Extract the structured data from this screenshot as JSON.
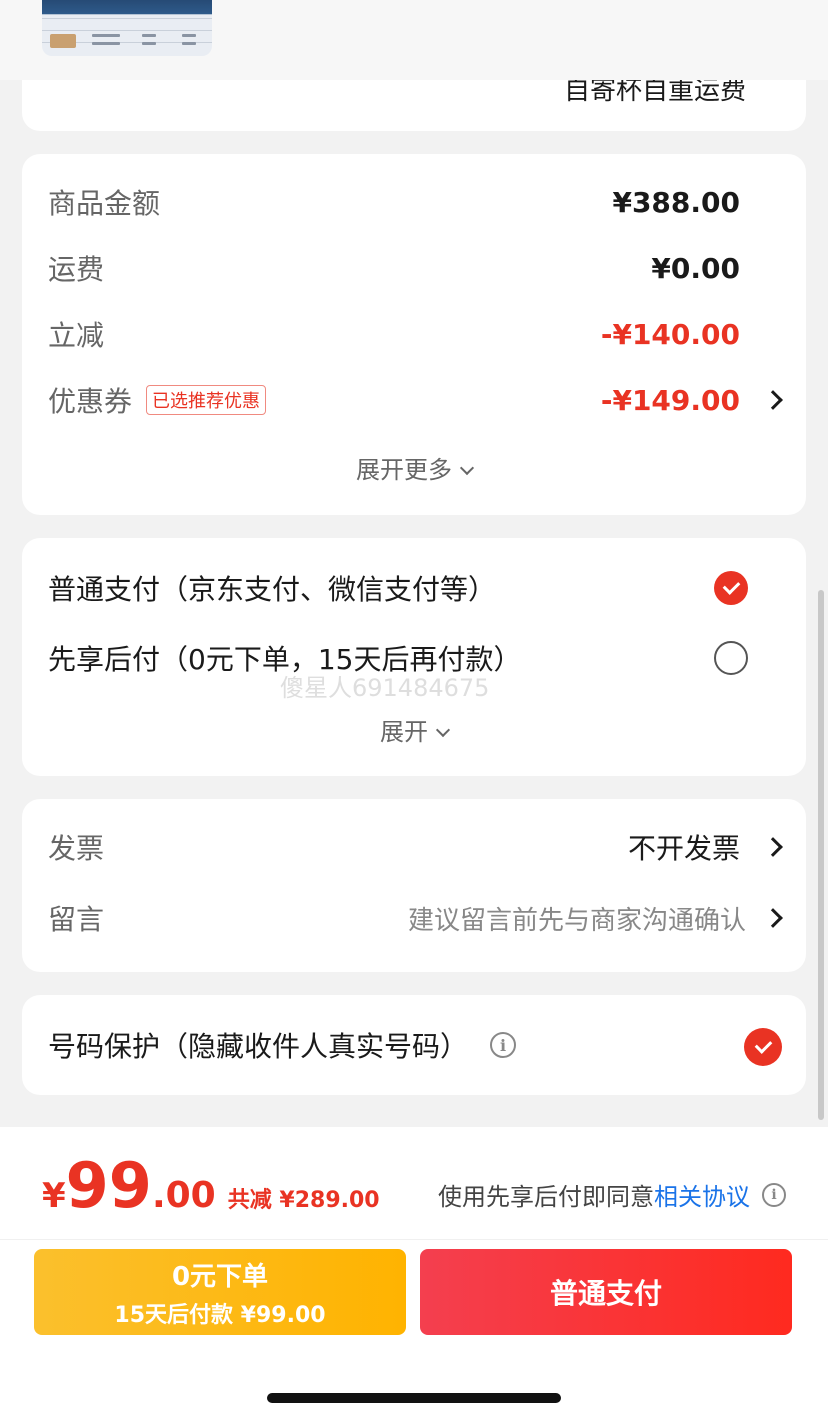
{
  "header": {
    "shipping_text": "自寄杯自重运费"
  },
  "price_summary": {
    "rows": [
      {
        "label": "商品金额",
        "value": "¥388.00"
      },
      {
        "label": "运费",
        "value": "¥0.00"
      },
      {
        "label": "立减",
        "value": "-¥140.00"
      },
      {
        "label": "优惠券",
        "tag": "已选推荐优惠",
        "value": "-¥149.00"
      }
    ],
    "expand_more": "展开更多"
  },
  "payment": {
    "options": [
      {
        "label": "普通支付（京东支付、微信支付等）",
        "selected": true
      },
      {
        "label": "先享后付（0元下单，15天后再付款）",
        "selected": false
      }
    ],
    "expand": "展开",
    "watermark": "傻星人691484675"
  },
  "invoice": {
    "invoice_label": "发票",
    "invoice_value": "不开发票",
    "message_label": "留言",
    "message_placeholder": "建议留言前先与商家沟通确认"
  },
  "protection": {
    "label": "号码保护（隐藏收件人真实号码）",
    "checked": true
  },
  "footer": {
    "currency": "¥",
    "total_int": "99",
    "total_dec": ".00",
    "saved": "共减 ¥289.00",
    "agree_text": "使用先享后付即同意",
    "agree_link": "相关协议",
    "btn_later_line1": "0元下单",
    "btn_later_line2": "15天后付款 ¥99.00",
    "btn_normal": "普通支付"
  },
  "colors": {
    "accent_red": "#e93323",
    "link_blue": "#1a73e8",
    "later_yellow": "#fbc02d"
  }
}
